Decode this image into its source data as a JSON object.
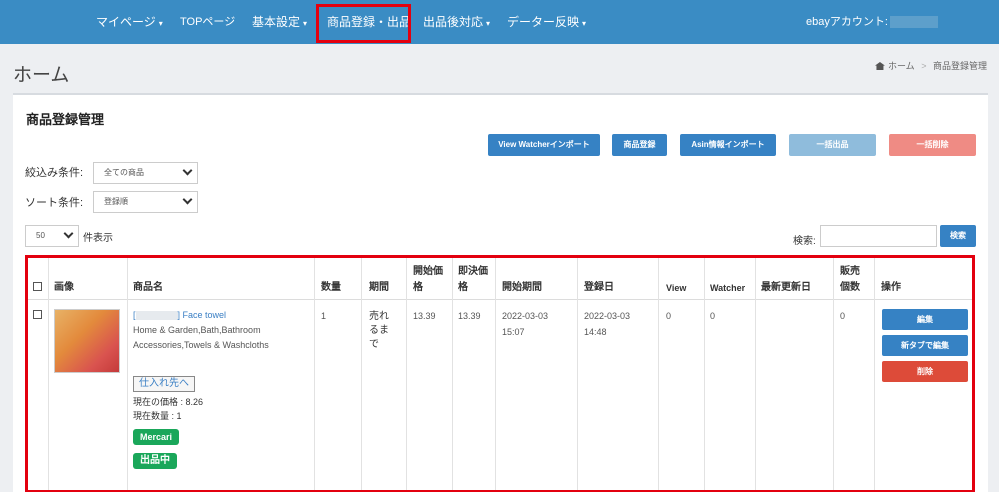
{
  "nav": {
    "items": [
      {
        "label": "マイページ",
        "dropdown": true
      },
      {
        "label": "TOPページ",
        "dropdown": false
      },
      {
        "label": "基本設定",
        "dropdown": true
      },
      {
        "label": "商品登録・出品",
        "dropdown": false
      },
      {
        "label": "出品後対応",
        "dropdown": true
      },
      {
        "label": "データー反映",
        "dropdown": true
      }
    ],
    "caret": "▾",
    "account_label": "ebayアカウント:"
  },
  "page": {
    "title": "ホーム",
    "breadcrumb_home": "ホーム",
    "breadcrumb_sep": ">",
    "breadcrumb_current": "商品登録管理"
  },
  "card": {
    "title": "商品登録管理",
    "buttons": {
      "view_watcher_import": "View Watcherインポート",
      "register_product": "商品登録",
      "asin_import": "Asin情報インポート",
      "bulk_list": "一括出品",
      "bulk_delete": "一括削除"
    },
    "filter": {
      "label": "絞込み条件:",
      "value": "全ての商品"
    },
    "sort": {
      "label": "ソート条件:",
      "value": "登録順"
    },
    "per_page": {
      "value": "50",
      "suffix": "件表示"
    },
    "search": {
      "label": "検索:",
      "button": "検索"
    }
  },
  "table": {
    "headers": {
      "image": "画像",
      "name": "商品名",
      "qty": "数量",
      "period": "期間",
      "start_price_1": "開始価",
      "start_price_2": "格",
      "buynow_1": "即決価",
      "buynow_2": "格",
      "start_period": "開始期間",
      "registered": "登録日",
      "view": "View",
      "watcher": "Watcher",
      "last_updated": "最新更新日",
      "sold_1": "販売",
      "sold_2": "個数",
      "actions": "操作"
    },
    "rows": [
      {
        "title_prefix": "[",
        "title_suffix": "] Face towel",
        "category_1": "Home & Garden,Bath,Bathroom",
        "category_2": "Accessories,Towels & Washcloths",
        "qty": "1",
        "period_1": "売れ",
        "period_2": "るま",
        "period_3": "で",
        "start_price": "13.39",
        "buynow_price": "13.39",
        "start_date": "2022-03-03",
        "start_time": "15:07",
        "reg_date": "2022-03-03",
        "reg_time": "14:48",
        "view": "0",
        "watcher": "0",
        "sold": "0",
        "supplier_button": "仕入れ先へ",
        "current_price": "現在の価格 : 8.26",
        "current_qty": "現在数量 : 1",
        "source_badge": "Mercari",
        "status_badge": "出品中",
        "actions": {
          "edit": "編集",
          "edit_new_tab": "新タブで編集",
          "delete": "削除"
        }
      }
    ]
  },
  "colors": {
    "topbar": "#3a8cc4",
    "primary": "#3682c4",
    "danger": "#dd4b39",
    "success": "#1aa75a",
    "highlight": "#e3000f"
  }
}
